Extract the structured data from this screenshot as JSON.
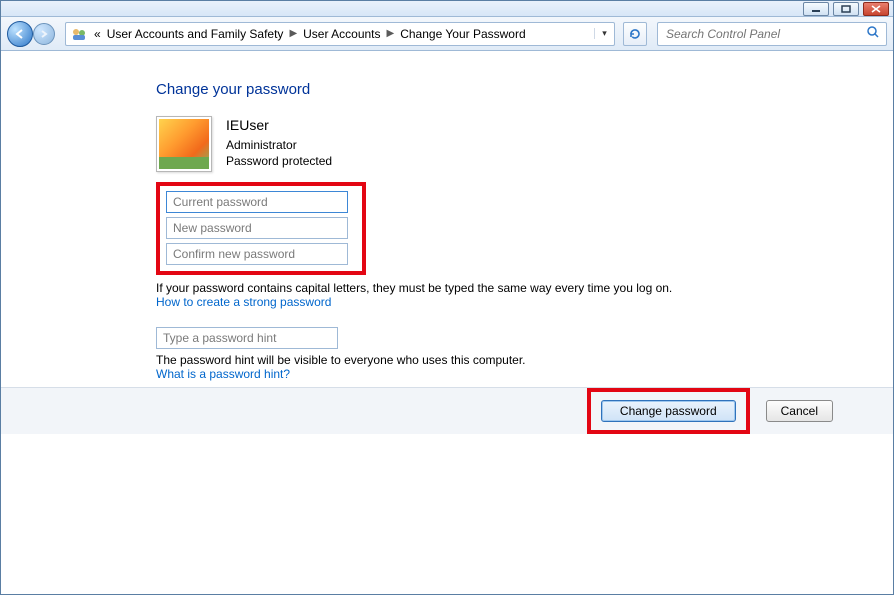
{
  "breadcrumb": {
    "prefix": "«",
    "item1": "User Accounts and Family Safety",
    "item2": "User Accounts",
    "item3": "Change Your Password"
  },
  "search": {
    "placeholder": "Search Control Panel"
  },
  "page": {
    "title": "Change your password",
    "user": {
      "name": "IEUser",
      "role": "Administrator",
      "status": "Password protected"
    },
    "fields": {
      "current_ph": "Current password",
      "new_ph": "New password",
      "confirm_ph": "Confirm new password",
      "hint_ph": "Type a password hint"
    },
    "caps_note": "If your password contains capital letters, they must be typed the same way every time you log on.",
    "link_strong": "How to create a strong password",
    "hint_note": "The password hint will be visible to everyone who uses this computer.",
    "link_hint": "What is a password hint?"
  },
  "buttons": {
    "change": "Change password",
    "cancel": "Cancel"
  },
  "highlights": {
    "box1": "password-fields-group",
    "box2": "change-password-button"
  }
}
